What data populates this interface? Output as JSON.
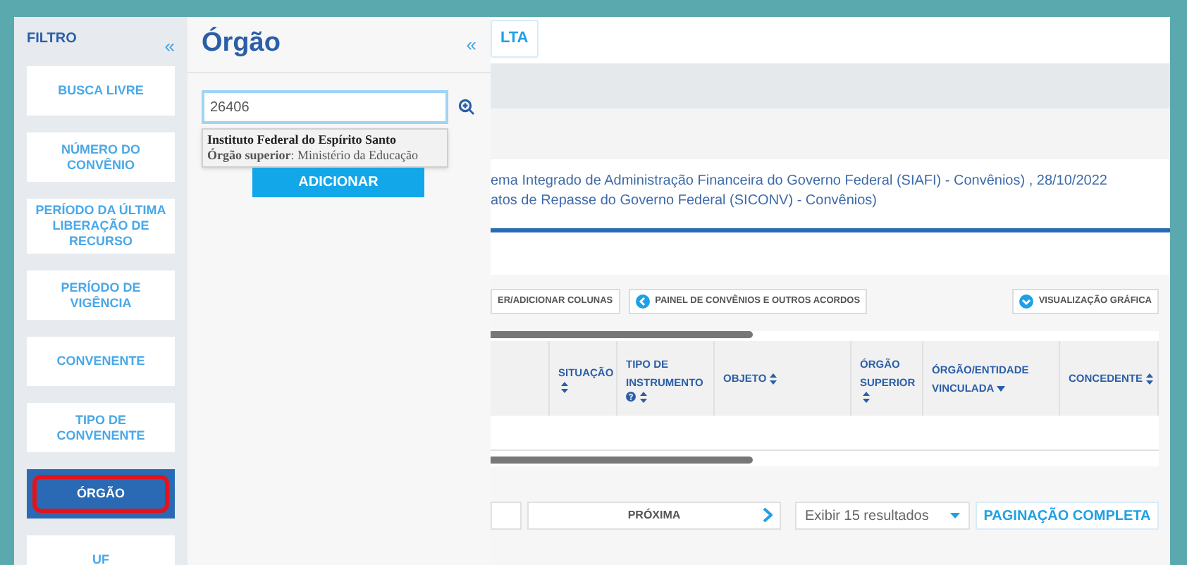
{
  "filter_sidebar": {
    "title": "FILTRO",
    "collapse": "«",
    "items": [
      {
        "label": "BUSCA LIVRE",
        "selected": false
      },
      {
        "label": "NÚMERO DO CONVÊNIO",
        "selected": false
      },
      {
        "label": "PERÍODO DA ÚLTIMA LIBERAÇÃO DE RECURSO",
        "selected": false
      },
      {
        "label": "PERÍODO DE VIGÊNCIA",
        "selected": false
      },
      {
        "label": "CONVENENTE",
        "selected": false
      },
      {
        "label": "TIPO DE CONVENENTE",
        "selected": false
      },
      {
        "label": "ÓRGÃO",
        "selected": true
      },
      {
        "label": "UF",
        "selected": false
      }
    ]
  },
  "filter_panel": {
    "title": "Órgão",
    "collapse": "«",
    "search": {
      "value": "26406"
    },
    "suggestion": {
      "name": "Instituto Federal do Espírito Santo",
      "detail": "**Órgão superior**: Ministério da Educação"
    },
    "add_button": "ADICIONAR"
  },
  "main": {
    "top_button": "LTA",
    "source_lines": [
      "ema Integrado de Administração Financeira do Governo Federal (SIAFI) - Convênios) , 28/10/2022",
      "atos de Repasse do Governo Federal (SICONV) - Convênios)"
    ],
    "toolbar": [
      {
        "label": "ER/ADICIONAR COLUNAS",
        "kind": "plain"
      },
      {
        "label": "PAINEL DE CONVÊNIOS E OUTROS ACORDOS",
        "kind": "back"
      },
      {
        "label": "VISUALIZAÇÃO GRÁFICA",
        "kind": "expand"
      }
    ],
    "table": {
      "columns": [
        {
          "label": "SITUAÇÃO",
          "sorted": false,
          "help": false
        },
        {
          "label": "TIPO DE INSTRUMENTO",
          "sorted": false,
          "help": true
        },
        {
          "label": "OBJETO",
          "sorted": false,
          "help": false
        },
        {
          "label": "ÓRGÃO SUPERIOR",
          "sorted": false,
          "help": false
        },
        {
          "label": "ÓRGÃO/ENTIDADE VINCULADA",
          "sorted": true,
          "help": false
        },
        {
          "label": "CONCEDENTE",
          "sorted": false,
          "help": false
        }
      ]
    },
    "pagination": {
      "next": "PRÓXIMA",
      "page_size": "Exibir 15 resultados",
      "full": "PAGINAÇÃO COMPLETA"
    }
  }
}
